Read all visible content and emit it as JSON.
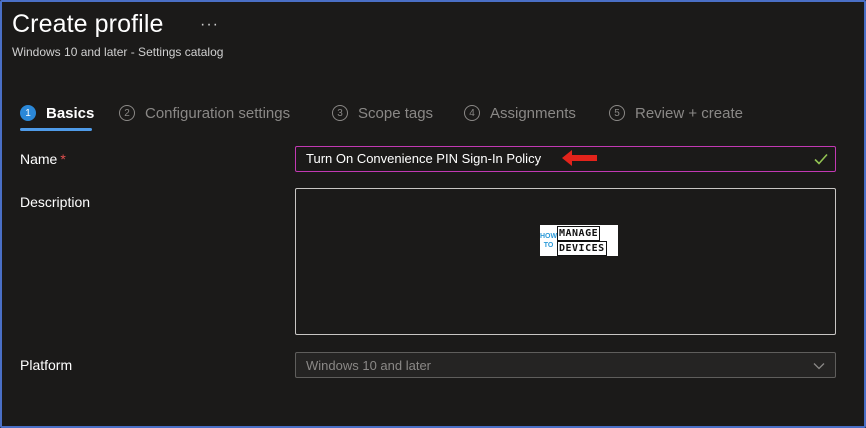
{
  "header": {
    "title": "Create profile",
    "more_label": "···",
    "subtitle": "Windows 10 and later - Settings catalog"
  },
  "steps": [
    {
      "number": "1",
      "label": "Basics",
      "active": true
    },
    {
      "number": "2",
      "label": "Configuration settings",
      "active": false
    },
    {
      "number": "3",
      "label": "Scope tags",
      "active": false
    },
    {
      "number": "4",
      "label": "Assignments",
      "active": false
    },
    {
      "number": "5",
      "label": "Review + create",
      "active": false
    }
  ],
  "form": {
    "name_label": "Name",
    "required_mark": "*",
    "name_value": "Turn On Convenience PIN Sign-In Policy",
    "description_label": "Description",
    "description_value": "",
    "platform_label": "Platform",
    "platform_value": "Windows 10 and later"
  },
  "watermark": {
    "left_top": "HOW",
    "left_bottom": "TO",
    "line1": "MANAGE",
    "line2": "DEVICES"
  },
  "colors": {
    "accent": "#2b88d8",
    "input_focus_border": "#c239b3",
    "valid_check": "#92c353",
    "annotation_arrow": "#e3231b"
  }
}
